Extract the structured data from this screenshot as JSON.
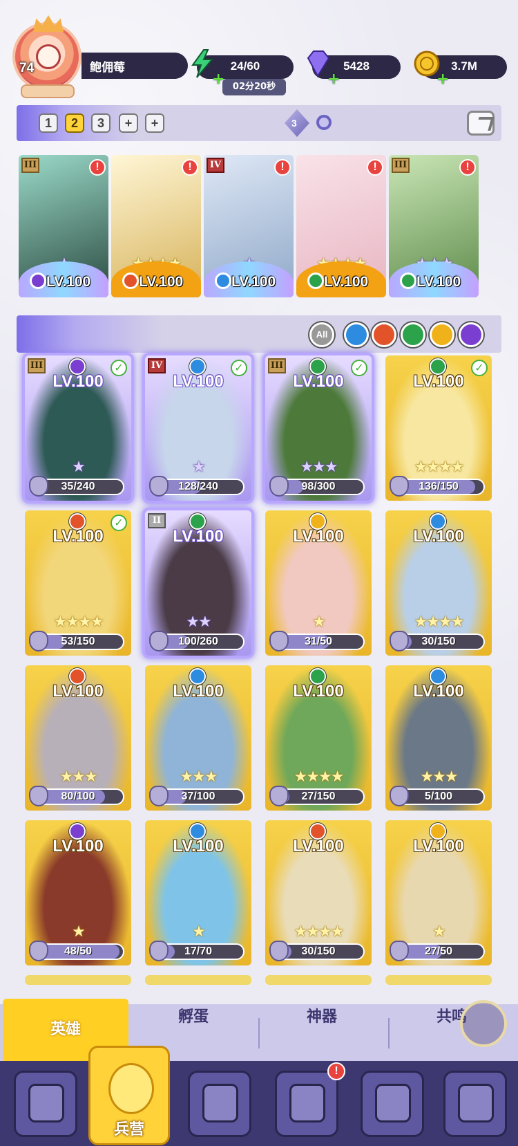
{
  "player": {
    "level": "74",
    "name": "鲍佣莓"
  },
  "resources": {
    "energy": "24/60",
    "energy_timer": "02分20秒",
    "gems": "5428",
    "gold": "3.7M"
  },
  "team_bar": {
    "presets": [
      "1",
      "2",
      "3"
    ],
    "active_preset": "2",
    "relic_count": "3"
  },
  "team": [
    {
      "rank": "III",
      "element": "dark",
      "level": "LV.100",
      "stars": 1,
      "star_style": "purple",
      "alert": "!"
    },
    {
      "rank": "",
      "element": "fire",
      "level": "LV.100",
      "stars": 4,
      "star_style": "gold",
      "alert": "!"
    },
    {
      "rank": "IV",
      "element": "water",
      "level": "LV.100",
      "stars": 1,
      "star_style": "purple",
      "alert": "!"
    },
    {
      "rank": "",
      "element": "nature",
      "level": "LV.100",
      "stars": 4,
      "star_style": "gold",
      "alert": "!"
    },
    {
      "rank": "III",
      "element": "nature",
      "level": "LV.100",
      "stars": 3,
      "star_style": "purple",
      "alert": "!"
    }
  ],
  "filters": {
    "all_label": "All",
    "elements": [
      "water",
      "fire",
      "nature",
      "light",
      "dark"
    ]
  },
  "heroes": [
    {
      "level": "LV.100",
      "element": "dark",
      "rank": "III",
      "checked": true,
      "highlight": true,
      "stars": 1,
      "star_style": "purple",
      "progress": "35/240",
      "ratio": 0.146
    },
    {
      "level": "LV.100",
      "element": "water",
      "rank": "IV",
      "checked": true,
      "highlight": true,
      "stars": 1,
      "star_style": "purple",
      "progress": "128/240",
      "ratio": 0.533
    },
    {
      "level": "LV.100",
      "element": "nature",
      "rank": "III",
      "checked": true,
      "highlight": true,
      "stars": 3,
      "star_style": "purple",
      "progress": "98/300",
      "ratio": 0.327
    },
    {
      "level": "LV.100",
      "element": "nature",
      "rank": "",
      "checked": true,
      "highlight": false,
      "stars": 4,
      "star_style": "gold",
      "progress": "136/150",
      "ratio": 0.907
    },
    {
      "level": "LV.100",
      "element": "fire",
      "rank": "",
      "checked": true,
      "highlight": false,
      "stars": 4,
      "star_style": "gold",
      "progress": "53/150",
      "ratio": 0.353
    },
    {
      "level": "LV.100",
      "element": "nature",
      "rank": "II",
      "checked": false,
      "highlight": true,
      "stars": 2,
      "star_style": "purple",
      "progress": "100/260",
      "ratio": 0.385
    },
    {
      "level": "LV.100",
      "element": "light",
      "rank": "",
      "checked": false,
      "highlight": false,
      "stars": 1,
      "star_style": "gold",
      "progress": "31/50",
      "ratio": 0.62
    },
    {
      "level": "LV.100",
      "element": "water",
      "rank": "",
      "checked": false,
      "highlight": false,
      "stars": 4,
      "star_style": "gold",
      "progress": "30/150",
      "ratio": 0.2
    },
    {
      "level": "LV.100",
      "element": "fire",
      "rank": "",
      "checked": false,
      "highlight": false,
      "stars": 3,
      "star_style": "gold",
      "progress": "80/100",
      "ratio": 0.8
    },
    {
      "level": "LV.100",
      "element": "water",
      "rank": "",
      "checked": false,
      "highlight": false,
      "stars": 3,
      "star_style": "gold",
      "progress": "37/100",
      "ratio": 0.37
    },
    {
      "level": "LV.100",
      "element": "nature",
      "rank": "",
      "checked": false,
      "highlight": false,
      "stars": 4,
      "star_style": "gold",
      "progress": "27/150",
      "ratio": 0.18
    },
    {
      "level": "LV.100",
      "element": "water",
      "rank": "",
      "checked": false,
      "highlight": false,
      "stars": 3,
      "star_style": "gold",
      "progress": "5/100",
      "ratio": 0.05
    },
    {
      "level": "LV.100",
      "element": "dark",
      "rank": "",
      "checked": false,
      "highlight": false,
      "stars": 1,
      "star_style": "gold",
      "progress": "48/50",
      "ratio": 0.96
    },
    {
      "level": "LV.100",
      "element": "water",
      "rank": "",
      "checked": false,
      "highlight": false,
      "stars": 1,
      "star_style": "gold",
      "progress": "17/70",
      "ratio": 0.243
    },
    {
      "level": "LV.100",
      "element": "fire",
      "rank": "",
      "checked": false,
      "highlight": false,
      "stars": 4,
      "star_style": "gold",
      "progress": "30/150",
      "ratio": 0.2
    },
    {
      "level": "LV.100",
      "element": "light",
      "rank": "",
      "checked": false,
      "highlight": false,
      "stars": 1,
      "star_style": "gold",
      "progress": "27/50",
      "ratio": 0.54
    }
  ],
  "tabs": [
    "英雄",
    "孵蛋",
    "神器",
    "共鸣"
  ],
  "active_tab": "英雄",
  "nav": {
    "active_label": "兵营",
    "alert": "!"
  },
  "colors": {
    "dark": "#7a3fd0",
    "fire": "#e2532a",
    "water": "#2d8be0",
    "nature": "#2ca24a",
    "light": "#f0b21a",
    "gold_card": "#f2c93a",
    "accent": "#ffcf24"
  }
}
